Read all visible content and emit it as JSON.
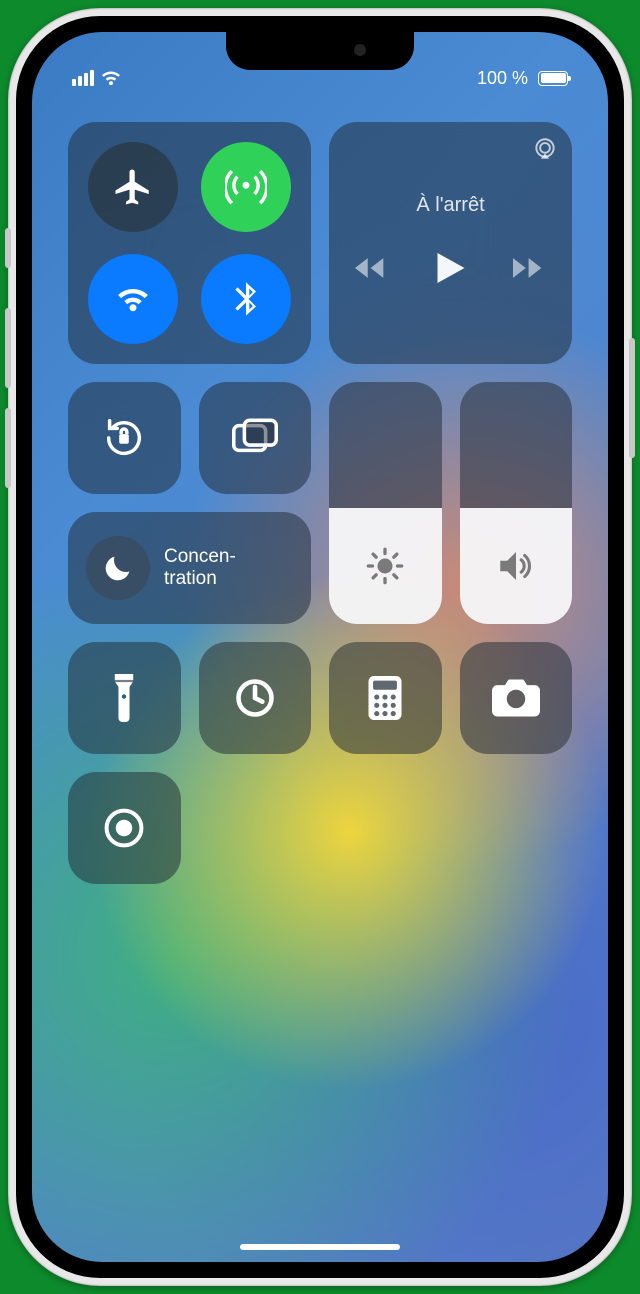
{
  "status": {
    "battery_text": "100 %"
  },
  "media": {
    "title": "À l'arrêt"
  },
  "focus": {
    "label": "Concen-\ntration"
  },
  "sliders": {
    "brightness_pct": 48,
    "volume_pct": 48
  },
  "toggles": {
    "airplane": false,
    "cellular": true,
    "wifi": true,
    "bluetooth": true,
    "orientation_lock": false,
    "screen_mirroring": false
  },
  "icons": {
    "airplane": "airplane",
    "cellular": "antenna",
    "wifi": "wifi",
    "bluetooth": "bluetooth",
    "orientation_lock": "rotation-lock",
    "mirror": "screen-mirroring",
    "moon": "moon",
    "flashlight": "flashlight",
    "timer": "timer",
    "calculator": "calculator",
    "camera": "camera",
    "record": "screen-record",
    "brightness": "sun",
    "volume": "speaker",
    "airplay": "airplay"
  }
}
